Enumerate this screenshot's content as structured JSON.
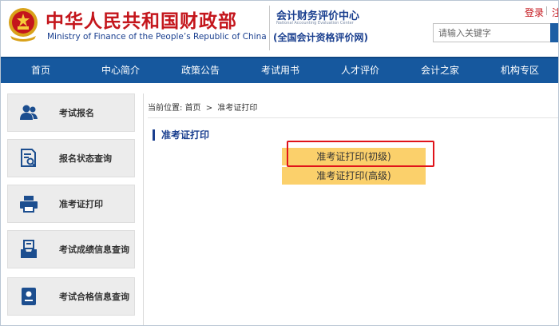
{
  "header": {
    "title_cn": "中华人民共和国财政部",
    "title_en": "Ministry of Finance of the People’s Republic of China",
    "center_cn": "会计财务评价中心",
    "center_en": "National Accounting Evaluation Center",
    "center_sub": "(全国会计资格评价网)",
    "login": "登录",
    "login_more": "注",
    "search_placeholder": "请输入关键字",
    "emblem_icon": "national-emblem",
    "colors": {
      "brand_red": "#c4161c",
      "brand_blue": "#1a3f8f",
      "nav_bg": "#16589e"
    }
  },
  "nav": {
    "items": [
      "首页",
      "中心简介",
      "政策公告",
      "考试用书",
      "人才评价",
      "会计之家",
      "机构专区"
    ]
  },
  "sidebar": {
    "items": [
      {
        "label": "考试报名",
        "icon": "users-icon"
      },
      {
        "label": "报名状态查询",
        "icon": "document-search-icon"
      },
      {
        "label": "准考证打印",
        "icon": "printer-icon"
      },
      {
        "label": "考试成绩信息查询",
        "icon": "inbox-icon"
      },
      {
        "label": "考试合格信息查询",
        "icon": "certificate-icon"
      }
    ],
    "icon_color": "#1c4e8f"
  },
  "breadcrumb": {
    "prefix": "当前位置:",
    "home": "首页",
    "separator": ">",
    "current": "准考证打印"
  },
  "content": {
    "section_title": "准考证打印",
    "options": [
      "准考证打印(初级)",
      "准考证打印(高级)"
    ],
    "option_color": "#fbd06b",
    "highlight_color": "#e0131a"
  }
}
